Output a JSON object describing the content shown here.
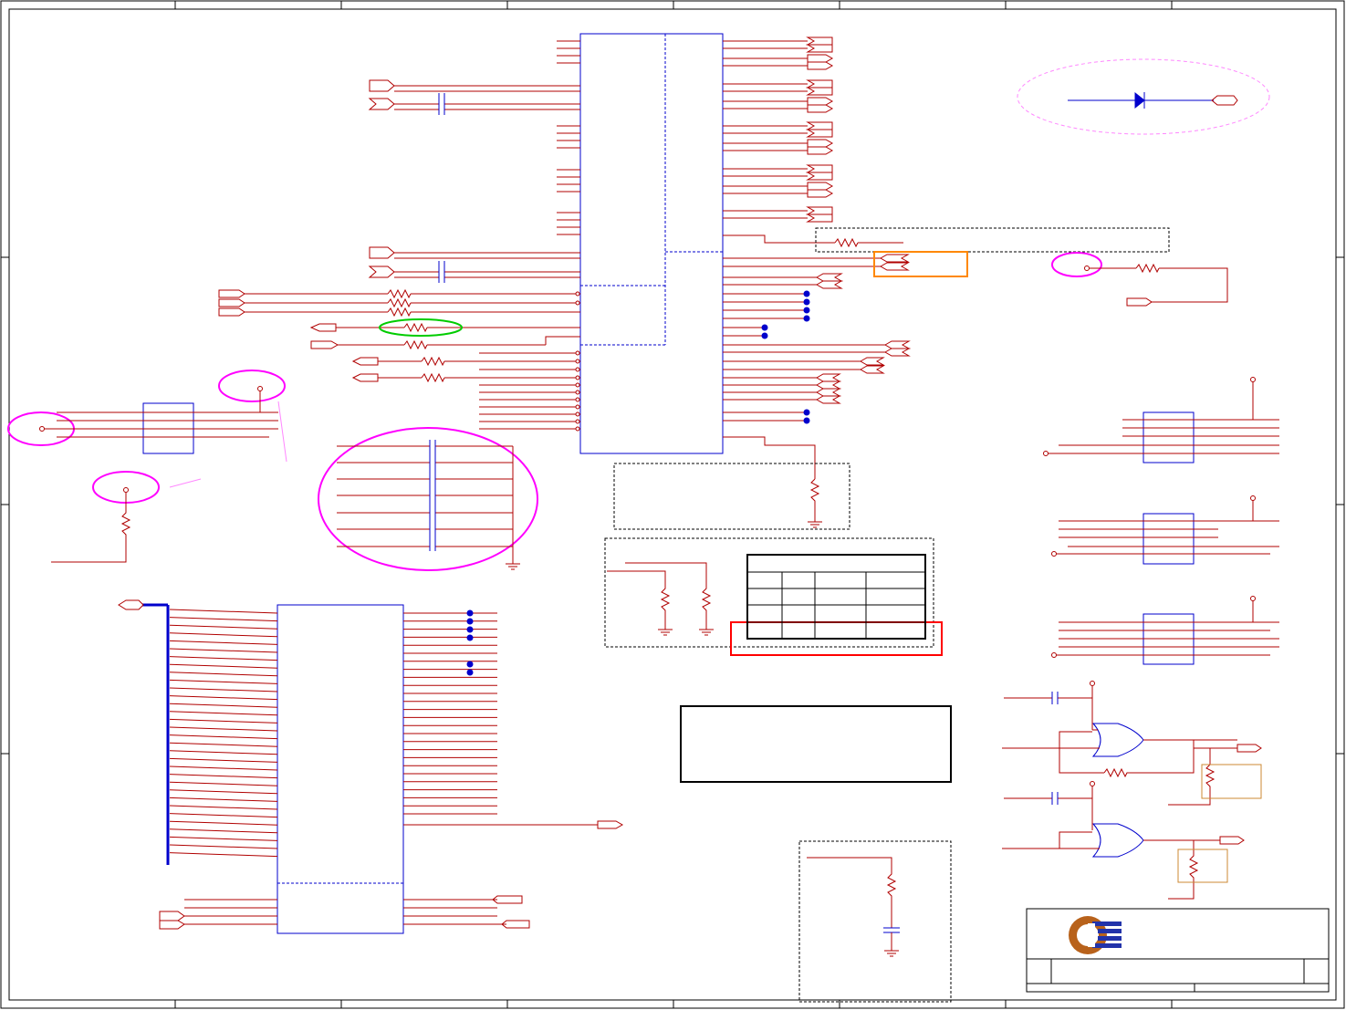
{
  "title_block": {
    "logo": "company-logo"
  },
  "colors": {
    "wire": "#b00000",
    "component": "#0000cc",
    "border": "#000000",
    "highlight_magenta": "#ff00ff",
    "highlight_green": "#00cc00",
    "highlight_orange": "#ff8800",
    "highlight_red": "#ff0000",
    "box_tan": "#cc8833"
  }
}
